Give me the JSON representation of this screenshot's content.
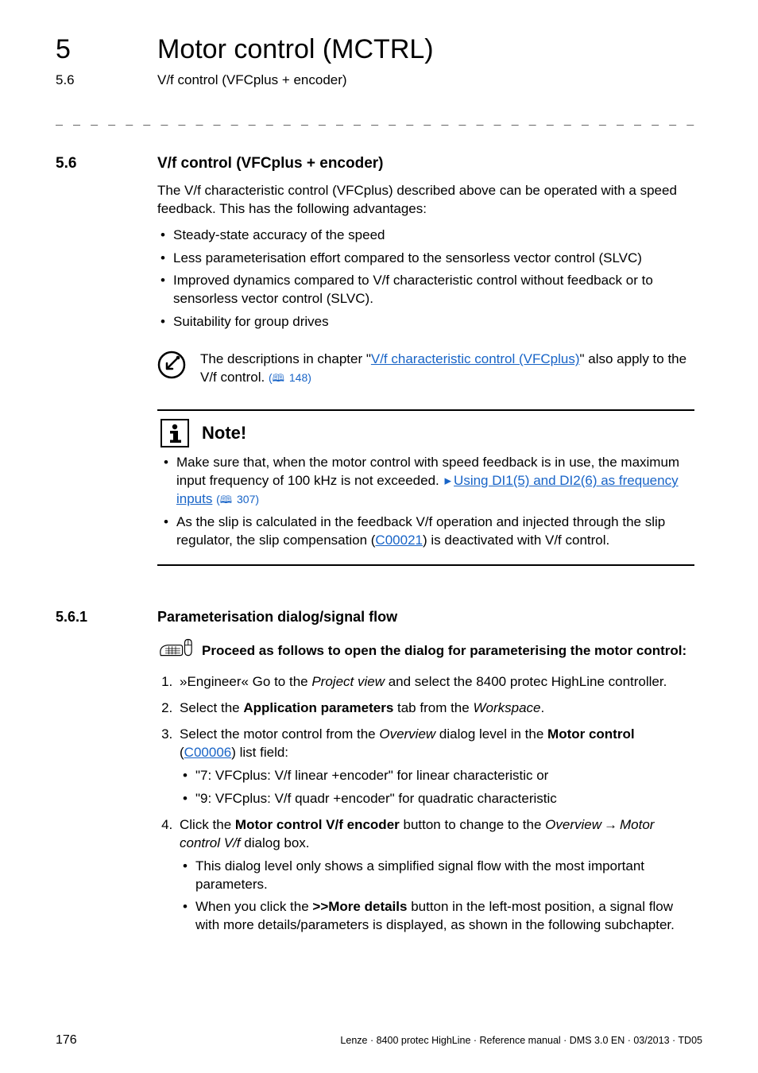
{
  "header": {
    "chapter_number": "5",
    "chapter_title": "Motor control (MCTRL)",
    "section_number_header": "5.6",
    "section_title_header": "V/f control (VFCplus + encoder)"
  },
  "section": {
    "number": "5.6",
    "title": "V/f control (VFCplus + encoder)",
    "intro": "The V/f characteristic control (VFCplus) described above can be operated with a speed feedback. This has the following advantages:",
    "bullets": [
      "Steady-state accuracy of the speed",
      "Less parameterisation effort compared to the sensorless vector control (SLVC)",
      "Improved dynamics compared to V/f characteristic control without feedback or to sensorless vector control (SLVC).",
      "Suitability for group drives"
    ],
    "tip_pre": "The descriptions in chapter \"",
    "tip_link": "V/f characteristic control (VFCplus)",
    "tip_post": "\" also apply to the V/f control.",
    "tip_pageref": "148"
  },
  "note": {
    "title": "Note!",
    "item1_pre": "Make sure that, when the motor control with speed feedback is in use, the maximum input frequency of 100 kHz is not exceeded.",
    "item1_link": "Using DI1(5) and DI2(6) as frequency inputs",
    "item1_pageref": "307",
    "item2_pre": "As the slip is calculated in the feedback V/f operation and injected through the slip regulator, the slip compensation (",
    "item2_link": "C00021",
    "item2_post": ") is deactivated with V/f control."
  },
  "subsection": {
    "number": "5.6.1",
    "title": "Parameterisation dialog/signal flow",
    "proceed": "Proceed as follows to open the dialog for parameterising the motor control:",
    "step1_pre": "»Engineer« Go to the ",
    "step1_italic": "Project view",
    "step1_post": " and select the 8400 protec HighLine controller.",
    "step2_pre": "Select the ",
    "step2_bold": "Application parameters",
    "step2_mid": " tab from the ",
    "step2_italic": "Workspace",
    "step2_post": ".",
    "step3_pre": "Select the motor control from the ",
    "step3_italic": "Overview",
    "step3_mid": " dialog level in the ",
    "step3_bold": "Motor control",
    "step3_paren_open": " (",
    "step3_link": "C00006",
    "step3_paren_close": ") list field:",
    "step3_sub1": "\"7: VFCplus: V/f linear +encoder\" for linear characteristic or",
    "step3_sub2": "\"9: VFCplus: V/f quadr +encoder\" for quadratic characteristic",
    "step4_pre": "Click the ",
    "step4_bold": "Motor control V/f encoder",
    "step4_mid": " button to change to the ",
    "step4_italic1": "Overview",
    "step4_arrow": "→",
    "step4_italic2": "Motor control V/f",
    "step4_post": " dialog box.",
    "step4_sub1": "This dialog level only shows a simplified signal flow with the most important parameters.",
    "step4_sub2_pre": "When you click the ",
    "step4_sub2_bold": ">>More details",
    "step4_sub2_post": " button in the left-most position, a signal flow with more details/parameters is displayed, as shown in the following subchapter."
  },
  "footer": {
    "page": "176",
    "right": "Lenze · 8400 protec HighLine · Reference manual · DMS 3.0 EN · 03/2013 · TD05"
  },
  "glyphs": {
    "book": "🕮",
    "triangle": "▸"
  }
}
